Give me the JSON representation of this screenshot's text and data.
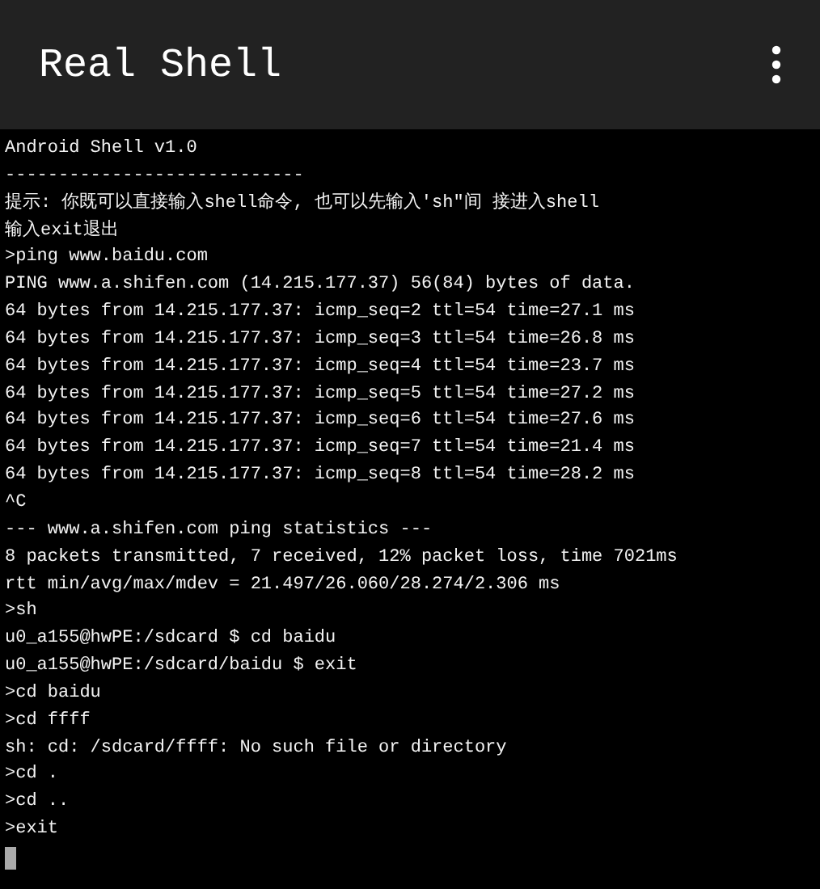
{
  "app_bar": {
    "title": "Real Shell"
  },
  "terminal": {
    "lines": [
      "Android Shell v1.0",
      "----------------------------",
      "提示: 你既可以直接输入shell命令, 也可以先输入'sh\"间 接进入shell",
      "输入exit退出",
      ">ping www.baidu.com",
      "PING www.a.shifen.com (14.215.177.37) 56(84) bytes of data.",
      "64 bytes from 14.215.177.37: icmp_seq=2 ttl=54 time=27.1 ms",
      "64 bytes from 14.215.177.37: icmp_seq=3 ttl=54 time=26.8 ms",
      "64 bytes from 14.215.177.37: icmp_seq=4 ttl=54 time=23.7 ms",
      "64 bytes from 14.215.177.37: icmp_seq=5 ttl=54 time=27.2 ms",
      "64 bytes from 14.215.177.37: icmp_seq=6 ttl=54 time=27.6 ms",
      "64 bytes from 14.215.177.37: icmp_seq=7 ttl=54 time=21.4 ms",
      "64 bytes from 14.215.177.37: icmp_seq=8 ttl=54 time=28.2 ms",
      "^C",
      "--- www.a.shifen.com ping statistics ---",
      "8 packets transmitted, 7 received, 12% packet loss, time 7021ms",
      "rtt min/avg/max/mdev = 21.497/26.060/28.274/2.306 ms",
      ">sh",
      "u0_a155@hwPE:/sdcard $ cd baidu",
      "u0_a155@hwPE:/sdcard/baidu $ exit",
      ">cd baidu",
      ">cd ffff",
      "sh: cd: /sdcard/ffff: No such file or directory",
      ">cd .",
      ">cd ..",
      ">exit"
    ]
  }
}
